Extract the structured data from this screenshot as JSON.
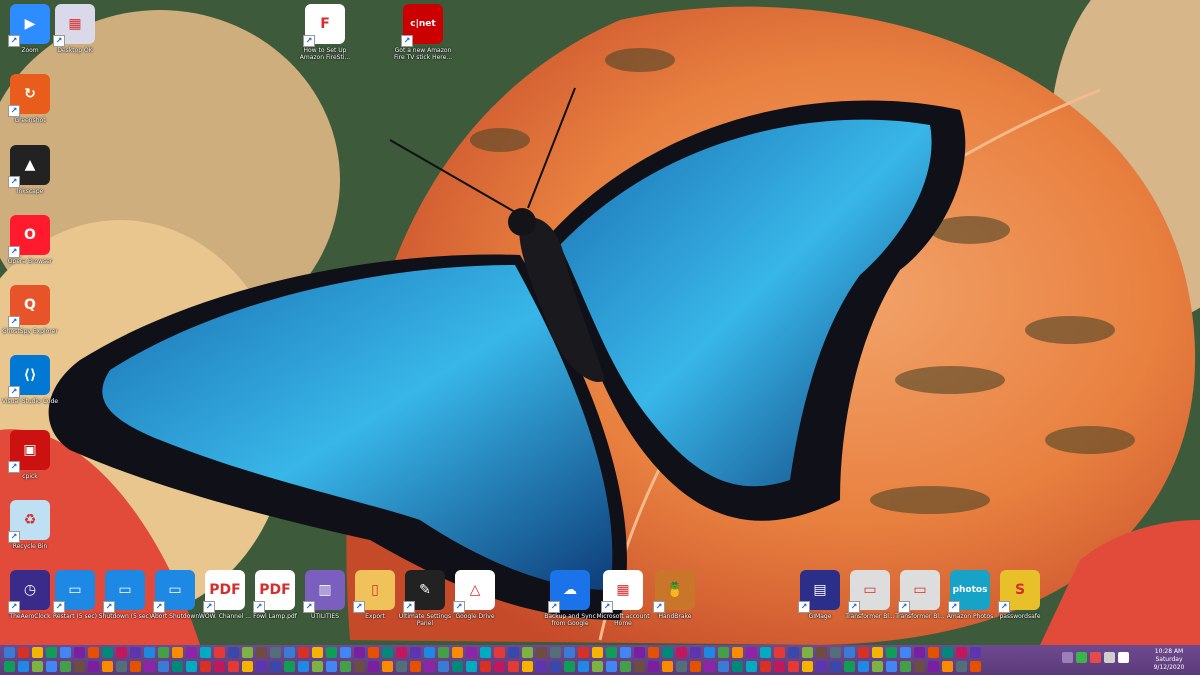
{
  "desktop_icons": [
    {
      "name": "zoom",
      "label": "Zoom",
      "color": "#2d8cff",
      "glyph": "▶"
    },
    {
      "name": "desktop-ok",
      "label": "Desktop OK",
      "color": "#d9d9ea",
      "glyph": "▦"
    },
    {
      "name": "how-to-setup-firestick",
      "label": "How to Set Up Amazon FireSti...",
      "color": "#ffffff",
      "glyph": "F"
    },
    {
      "name": "cnet-fire-tv",
      "label": "Got a new Amazon Fire TV stick Here...",
      "color": "#cc0000",
      "glyph": "c|net"
    },
    {
      "name": "greenshot",
      "label": "Greenshot",
      "color": "#e85d1c",
      "glyph": "↻"
    },
    {
      "name": "inkscape",
      "label": "Inkscape",
      "color": "#222222",
      "glyph": "▲"
    },
    {
      "name": "opera-browser",
      "label": "Opera Browser",
      "color": "#ff1b2d",
      "glyph": "O"
    },
    {
      "name": "ghostery",
      "label": "GhostSpy Explorer",
      "color": "#e8542a",
      "glyph": "Q"
    },
    {
      "name": "vscode",
      "label": "Visual Studio Code",
      "color": "#0078d4",
      "glyph": "⟨⟩"
    },
    {
      "name": "cpick",
      "label": "cpick",
      "color": "#cc1111",
      "glyph": "▣"
    },
    {
      "name": "recycle-bin",
      "label": "Recycle Bin",
      "color": "#bfe0f2",
      "glyph": "♻"
    },
    {
      "name": "aeroclock",
      "label": "TheAeroClock",
      "color": "#3a2a8a",
      "glyph": "◷"
    },
    {
      "name": "restart",
      "label": "Restart (5 sec)",
      "color": "#1e88e5",
      "glyph": "▭"
    },
    {
      "name": "shutdown-5",
      "label": "Shutdown (5 sec)",
      "color": "#1e88e5",
      "glyph": "▭"
    },
    {
      "name": "abort-shutdown",
      "label": "Abort Shutdown",
      "color": "#1e88e5",
      "glyph": "▭"
    },
    {
      "name": "pdf-1",
      "label": "WOW. Channel ...",
      "color": "#ffffff",
      "glyph": "PDF"
    },
    {
      "name": "pdf-2",
      "label": "Fowl Lamp.pdf",
      "color": "#ffffff",
      "glyph": "PDF"
    },
    {
      "name": "utilities",
      "label": "UTILITIES",
      "color": "#7a5fbf",
      "glyph": "▥"
    },
    {
      "name": "export",
      "label": "Export",
      "color": "#f0c35a",
      "glyph": "▯"
    },
    {
      "name": "ultimate-settings",
      "label": "Ultimate Settings Panel",
      "color": "#222222",
      "glyph": "✎"
    },
    {
      "name": "google-drive",
      "label": "Google Drive",
      "color": "#ffffff",
      "glyph": "△"
    },
    {
      "name": "backup-sync",
      "label": "Backup and Sync from Google",
      "color": "#1a73e8",
      "glyph": "☁"
    },
    {
      "name": "microsoft-account",
      "label": "Microsoft account Home",
      "color": "#ffffff",
      "glyph": "▦"
    },
    {
      "name": "handbrake",
      "label": "HandBrake",
      "color": "#c9762a",
      "glyph": "🍍"
    },
    {
      "name": "gimage",
      "label": "GIMage",
      "color": "#2b2f8a",
      "glyph": "▤"
    },
    {
      "name": "doc-thumb-1",
      "label": "Transformer Bl...",
      "color": "#dddddd",
      "glyph": "▭"
    },
    {
      "name": "doc-thumb-2",
      "label": "Transformer Bl...",
      "color": "#dddddd",
      "glyph": "▭"
    },
    {
      "name": "amazon-photos",
      "label": "Amazon Photos",
      "color": "#16a3c7",
      "glyph": "photos"
    },
    {
      "name": "passwordsafe",
      "label": "passwordsafe",
      "color": "#e8c02a",
      "glyph": "S"
    }
  ],
  "taskbar_colors": [
    "#3a7bd5",
    "#d93025",
    "#f4b400",
    "#0f9d58",
    "#4285f4",
    "#7b1fa2",
    "#e65100",
    "#00897b",
    "#c2185b",
    "#5e35b1",
    "#1e88e5",
    "#43a047",
    "#fb8c00",
    "#8e24aa",
    "#00acc1",
    "#e53935",
    "#3949ab",
    "#7cb342",
    "#6d4c41",
    "#546e7a"
  ],
  "clock": {
    "time": "10:28 AM",
    "day": "Saturday",
    "date": "9/12/2020"
  }
}
